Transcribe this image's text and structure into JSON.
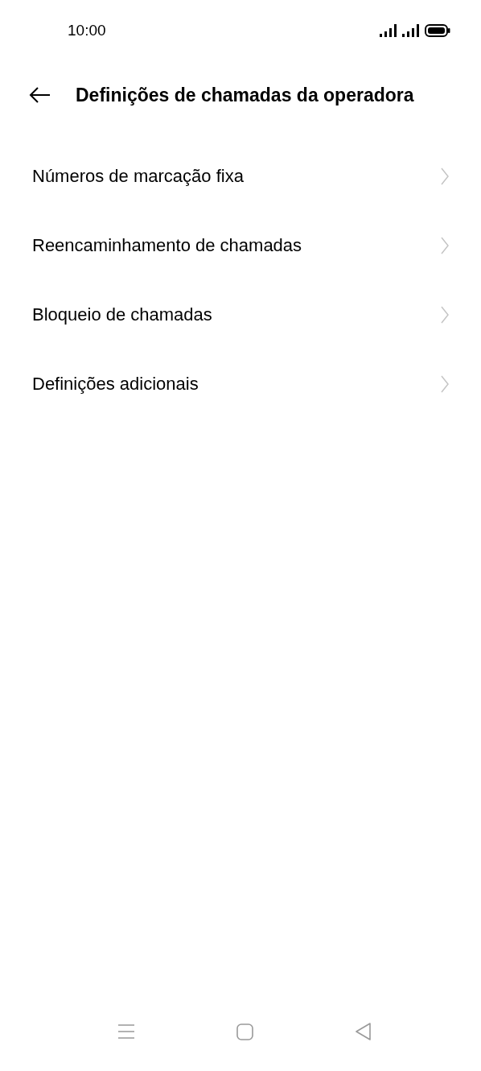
{
  "status_bar": {
    "time": "10:00"
  },
  "header": {
    "title": "Definições de chamadas da operadora"
  },
  "items": [
    {
      "label": "Números de marcação fixa"
    },
    {
      "label": "Reencaminhamento de chamadas"
    },
    {
      "label": "Bloqueio de chamadas"
    },
    {
      "label": "Definições adicionais"
    }
  ]
}
